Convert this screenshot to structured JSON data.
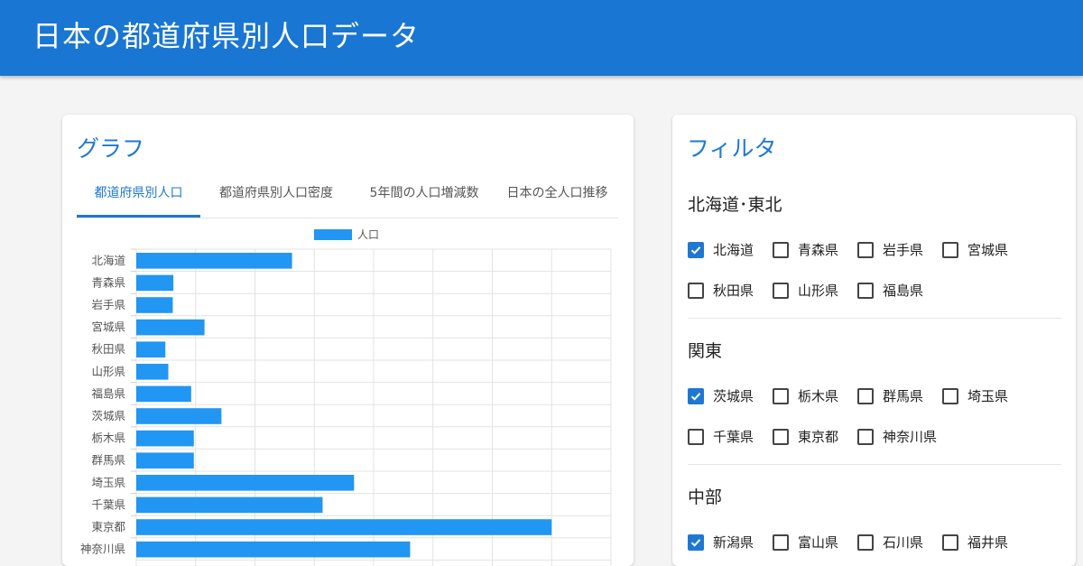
{
  "header": {
    "title": "日本の都道府県別人口データ"
  },
  "graph_card": {
    "title": "グラフ",
    "tabs": [
      {
        "label": "都道府県別人口",
        "active": true
      },
      {
        "label": "都道府県別人口密度",
        "active": false
      },
      {
        "label": "5年間の人口増減数",
        "active": false
      },
      {
        "label": "日本の全人口推移",
        "active": false
      }
    ]
  },
  "chart_data": {
    "type": "bar",
    "orientation": "horizontal",
    "legend": "人口",
    "legend_position": "top-center",
    "bar_color": "#2196f3",
    "grid": true,
    "categories": [
      "北海道",
      "青森県",
      "岩手県",
      "宮城県",
      "秋田県",
      "山形県",
      "福島県",
      "茨城県",
      "栃木県",
      "群馬県",
      "埼玉県",
      "千葉県",
      "東京都",
      "神奈川県"
    ],
    "series": [
      {
        "name": "人口",
        "values": [
          5250000,
          1250000,
          1230000,
          2300000,
          980000,
          1080000,
          1850000,
          2870000,
          1940000,
          1940000,
          7340000,
          6280000,
          14000000,
          9230000
        ]
      }
    ],
    "xlim": [
      0,
      16000000
    ]
  },
  "filter_card": {
    "title": "フィルタ",
    "regions": [
      {
        "name": "北海道･東北",
        "items": [
          {
            "label": "北海道",
            "checked": true
          },
          {
            "label": "青森県",
            "checked": false
          },
          {
            "label": "岩手県",
            "checked": false
          },
          {
            "label": "宮城県",
            "checked": false
          },
          {
            "label": "秋田県",
            "checked": false
          },
          {
            "label": "山形県",
            "checked": false
          },
          {
            "label": "福島県",
            "checked": false
          }
        ]
      },
      {
        "name": "関東",
        "items": [
          {
            "label": "茨城県",
            "checked": true
          },
          {
            "label": "栃木県",
            "checked": false
          },
          {
            "label": "群馬県",
            "checked": false
          },
          {
            "label": "埼玉県",
            "checked": false
          },
          {
            "label": "千葉県",
            "checked": false
          },
          {
            "label": "東京都",
            "checked": false
          },
          {
            "label": "神奈川県",
            "checked": false
          }
        ]
      },
      {
        "name": "中部",
        "items": [
          {
            "label": "新潟県",
            "checked": true
          },
          {
            "label": "富山県",
            "checked": false
          },
          {
            "label": "石川県",
            "checked": false
          },
          {
            "label": "福井県",
            "checked": false
          }
        ]
      }
    ]
  }
}
